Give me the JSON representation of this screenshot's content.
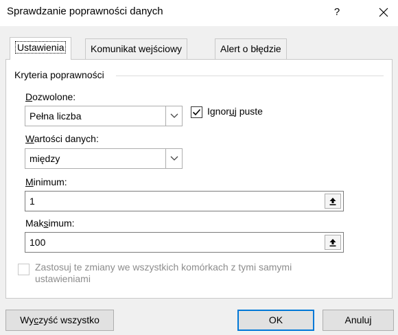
{
  "window": {
    "title": "Sprawdzanie poprawności danych",
    "help_label": "?",
    "close_label": "✕"
  },
  "tabs": [
    {
      "label": "Ustawienia",
      "active": true
    },
    {
      "label": "Komunikat wejściowy",
      "active": false
    },
    {
      "label": "Alert o błędzie",
      "active": false
    }
  ],
  "criteria": {
    "group_label": "Kryteria poprawności",
    "allowed_label": "Dozwolone:",
    "allowed_value": "Pełna liczba",
    "ignore_blank_label": "Ignoruj puste",
    "ignore_blank_checked": true,
    "data_label": "Wartości danych:",
    "data_value": "między",
    "minimum_label": "Minimum:",
    "minimum_value": "1",
    "maximum_label": "Maksimum:",
    "maximum_value": "100"
  },
  "apply_all": {
    "label_line1": "Zastosuj te zmiany we wszystkich komórkach z tymi samymi",
    "label_line2": "ustawieniami",
    "checked": false,
    "enabled": false
  },
  "buttons": {
    "clear_all": "Wyczyść wszystko",
    "ok": "OK",
    "cancel": "Anuluj"
  },
  "icons": {
    "dropdown": "chevron-down-icon",
    "checkmark": "checkmark-icon",
    "range_select": "collapse-dialog-icon"
  }
}
